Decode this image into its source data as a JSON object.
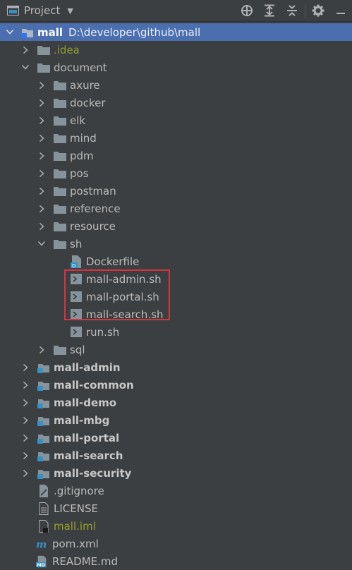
{
  "toolbar": {
    "title": "Project",
    "icons": [
      "crosshair-icon",
      "expand-all-icon",
      "collapse-all-icon",
      "gear-icon",
      "minimize-icon"
    ]
  },
  "colors": {
    "selection": "#4b6eaf",
    "folder": "#87939a",
    "idea_text": "#8f9a2c",
    "highlight_border": "#d9333f"
  },
  "tree": {
    "root": {
      "name": "mall",
      "path": "D:\\developer\\github\\mall"
    },
    "items": [
      {
        "label": "mall",
        "path": "D:\\developer\\github\\mall",
        "icon": "module-folder-icon",
        "arrow": "expanded"
      },
      {
        "label": ".idea",
        "icon": "folder-icon",
        "arrow": "collapsed"
      },
      {
        "label": "document",
        "icon": "folder-icon",
        "arrow": "expanded"
      },
      {
        "label": "axure",
        "icon": "folder-icon",
        "arrow": "collapsed"
      },
      {
        "label": "docker",
        "icon": "folder-icon",
        "arrow": "collapsed"
      },
      {
        "label": "elk",
        "icon": "folder-icon",
        "arrow": "collapsed"
      },
      {
        "label": "mind",
        "icon": "folder-icon",
        "arrow": "collapsed"
      },
      {
        "label": "pdm",
        "icon": "folder-icon",
        "arrow": "collapsed"
      },
      {
        "label": "pos",
        "icon": "folder-icon",
        "arrow": "collapsed"
      },
      {
        "label": "postman",
        "icon": "folder-icon",
        "arrow": "collapsed"
      },
      {
        "label": "reference",
        "icon": "folder-icon",
        "arrow": "collapsed"
      },
      {
        "label": "resource",
        "icon": "folder-icon",
        "arrow": "collapsed"
      },
      {
        "label": "sh",
        "icon": "folder-icon",
        "arrow": "expanded"
      },
      {
        "label": "Dockerfile",
        "icon": "dockerfile-icon"
      },
      {
        "label": "mall-admin.sh",
        "icon": "shell-script-icon"
      },
      {
        "label": "mall-portal.sh",
        "icon": "shell-script-icon"
      },
      {
        "label": "mall-search.sh",
        "icon": "shell-script-icon"
      },
      {
        "label": "run.sh",
        "icon": "shell-script-icon"
      },
      {
        "label": "sql",
        "icon": "folder-icon",
        "arrow": "collapsed"
      },
      {
        "label": "mall-admin",
        "icon": "module-folder-icon",
        "arrow": "collapsed"
      },
      {
        "label": "mall-common",
        "icon": "module-folder-icon",
        "arrow": "collapsed"
      },
      {
        "label": "mall-demo",
        "icon": "module-folder-icon",
        "arrow": "collapsed"
      },
      {
        "label": "mall-mbg",
        "icon": "module-folder-icon",
        "arrow": "collapsed"
      },
      {
        "label": "mall-portal",
        "icon": "module-folder-icon",
        "arrow": "collapsed"
      },
      {
        "label": "mall-search",
        "icon": "module-folder-icon",
        "arrow": "collapsed"
      },
      {
        "label": "mall-security",
        "icon": "module-folder-icon",
        "arrow": "collapsed"
      },
      {
        "label": ".gitignore",
        "icon": "gitignore-file-icon"
      },
      {
        "label": "LICENSE",
        "icon": "text-file-icon"
      },
      {
        "label": "mall.iml",
        "icon": "iml-file-icon"
      },
      {
        "label": "pom.xml",
        "icon": "maven-pom-icon"
      },
      {
        "label": "README.md",
        "icon": "markdown-file-icon"
      }
    ]
  }
}
